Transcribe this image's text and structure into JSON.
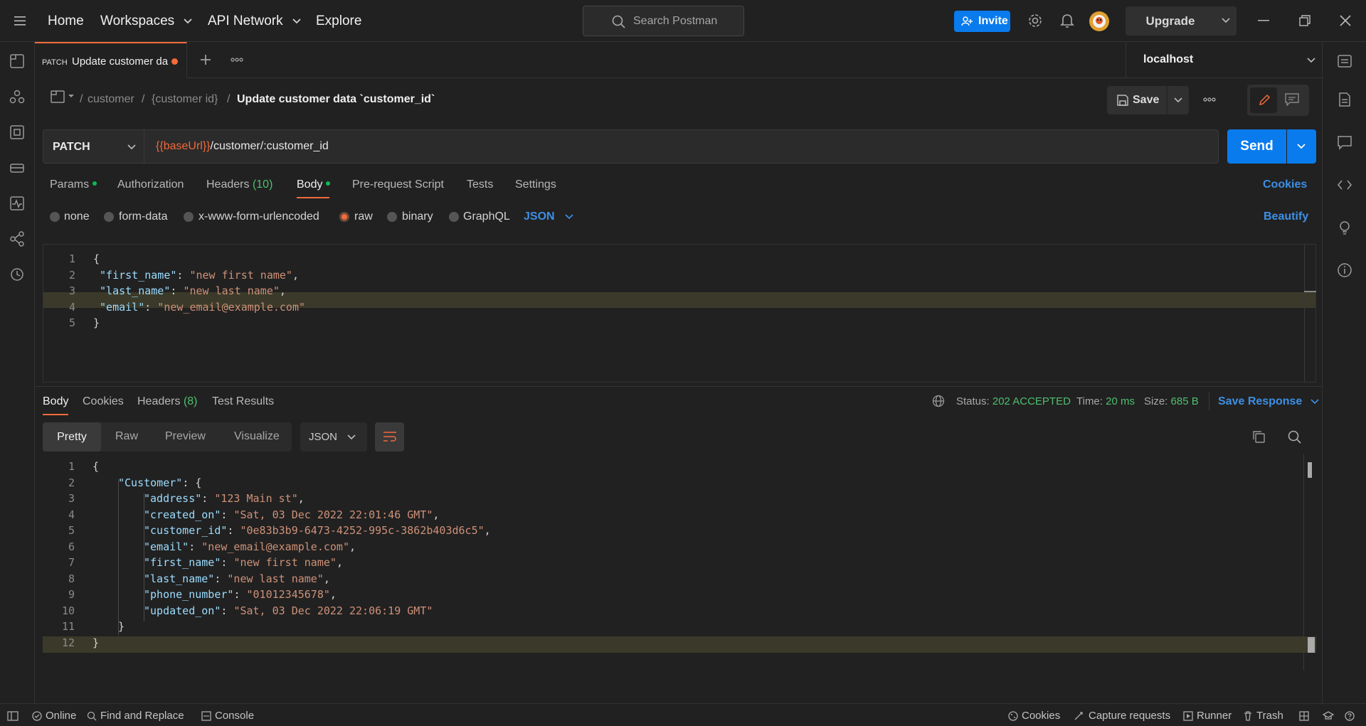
{
  "topbar": {
    "home": "Home",
    "workspaces": "Workspaces",
    "api_network": "API Network",
    "explore": "Explore",
    "search_placeholder": "Search Postman",
    "invite": "Invite",
    "upgrade": "Upgrade"
  },
  "tab": {
    "method": "PATCH",
    "name": "Update customer da"
  },
  "environment": "localhost",
  "breadcrumb": {
    "part1": "customer",
    "part2": "{customer id}",
    "title": "Update customer data `customer_id`"
  },
  "toolbar": {
    "save": "Save"
  },
  "request": {
    "method": "PATCH",
    "url_var": "{{baseUrl}}",
    "url_path": "/customer/:customer_id",
    "send": "Send"
  },
  "request_tabs": {
    "params": "Params",
    "authorization": "Authorization",
    "headers": "Headers",
    "headers_count": "(10)",
    "body": "Body",
    "prerequest": "Pre-request Script",
    "tests": "Tests",
    "settings": "Settings",
    "cookies": "Cookies"
  },
  "body_types": {
    "none": "none",
    "form_data": "form-data",
    "urlencoded": "x-www-form-urlencoded",
    "raw": "raw",
    "binary": "binary",
    "graphql": "GraphQL",
    "language": "JSON",
    "beautify": "Beautify"
  },
  "request_body_lines": [
    {
      "n": "1",
      "k": "",
      "v": "",
      "pre": "{",
      "post": ""
    },
    {
      "n": "2",
      "k": "\"first_name\"",
      "v": "\"new first name\"",
      "pre": " ",
      "post": ","
    },
    {
      "n": "3",
      "k": "\"last_name\"",
      "v": "\"new last name\"",
      "pre": " ",
      "post": ","
    },
    {
      "n": "4",
      "k": "\"email\"",
      "v": "\"new_email@example.com\"",
      "pre": " ",
      "post": ""
    },
    {
      "n": "5",
      "k": "",
      "v": "",
      "pre": "}",
      "post": ""
    }
  ],
  "response_tabs": {
    "body": "Body",
    "cookies": "Cookies",
    "headers": "Headers",
    "headers_count": "(8)",
    "test_results": "Test Results"
  },
  "response_status": {
    "status_label": "Status:",
    "status_value": "202 ACCEPTED",
    "time_label": "Time:",
    "time_value": "20 ms",
    "size_label": "Size:",
    "size_value": "685 B",
    "save_response": "Save Response"
  },
  "response_view": {
    "pretty": "Pretty",
    "raw": "Raw",
    "preview": "Preview",
    "visualize": "Visualize",
    "format": "JSON"
  },
  "response_body_lines": [
    {
      "n": "1",
      "indent": 0,
      "k": "",
      "v": "",
      "pre": "{",
      "post": ""
    },
    {
      "n": "2",
      "indent": 1,
      "k": "\"Customer\"",
      "v": "",
      "pre": "",
      "post": ": {"
    },
    {
      "n": "3",
      "indent": 2,
      "k": "\"address\"",
      "v": "\"123 Main st\"",
      "pre": "",
      "post": ","
    },
    {
      "n": "4",
      "indent": 2,
      "k": "\"created_on\"",
      "v": "\"Sat, 03 Dec 2022 22:01:46 GMT\"",
      "pre": "",
      "post": ","
    },
    {
      "n": "5",
      "indent": 2,
      "k": "\"customer_id\"",
      "v": "\"0e83b3b9-6473-4252-995c-3862b403d6c5\"",
      "pre": "",
      "post": ","
    },
    {
      "n": "6",
      "indent": 2,
      "k": "\"email\"",
      "v": "\"new_email@example.com\"",
      "pre": "",
      "post": ","
    },
    {
      "n": "7",
      "indent": 2,
      "k": "\"first_name\"",
      "v": "\"new first name\"",
      "pre": "",
      "post": ","
    },
    {
      "n": "8",
      "indent": 2,
      "k": "\"last_name\"",
      "v": "\"new last name\"",
      "pre": "",
      "post": ","
    },
    {
      "n": "9",
      "indent": 2,
      "k": "\"phone_number\"",
      "v": "\"01012345678\"",
      "pre": "",
      "post": ","
    },
    {
      "n": "10",
      "indent": 2,
      "k": "\"updated_on\"",
      "v": "\"Sat, 03 Dec 2022 22:06:19 GMT\"",
      "pre": "",
      "post": ""
    },
    {
      "n": "11",
      "indent": 1,
      "k": "",
      "v": "",
      "pre": "}",
      "post": ""
    },
    {
      "n": "12",
      "indent": 0,
      "k": "",
      "v": "",
      "pre": "}",
      "post": ""
    }
  ],
  "bottombar": {
    "online": "Online",
    "find_replace": "Find and Replace",
    "console": "Console",
    "cookies": "Cookies",
    "capture": "Capture requests",
    "runner": "Runner",
    "trash": "Trash"
  },
  "colors": {
    "accent": "#f26b3a",
    "primary": "#097bed",
    "success": "#4fbf6e"
  },
  "icons": [
    "menu-icon",
    "search-icon",
    "invite-user-icon",
    "settings-icon",
    "bell-icon",
    "avatar",
    "minimize-icon",
    "restore-icon",
    "close-icon"
  ]
}
